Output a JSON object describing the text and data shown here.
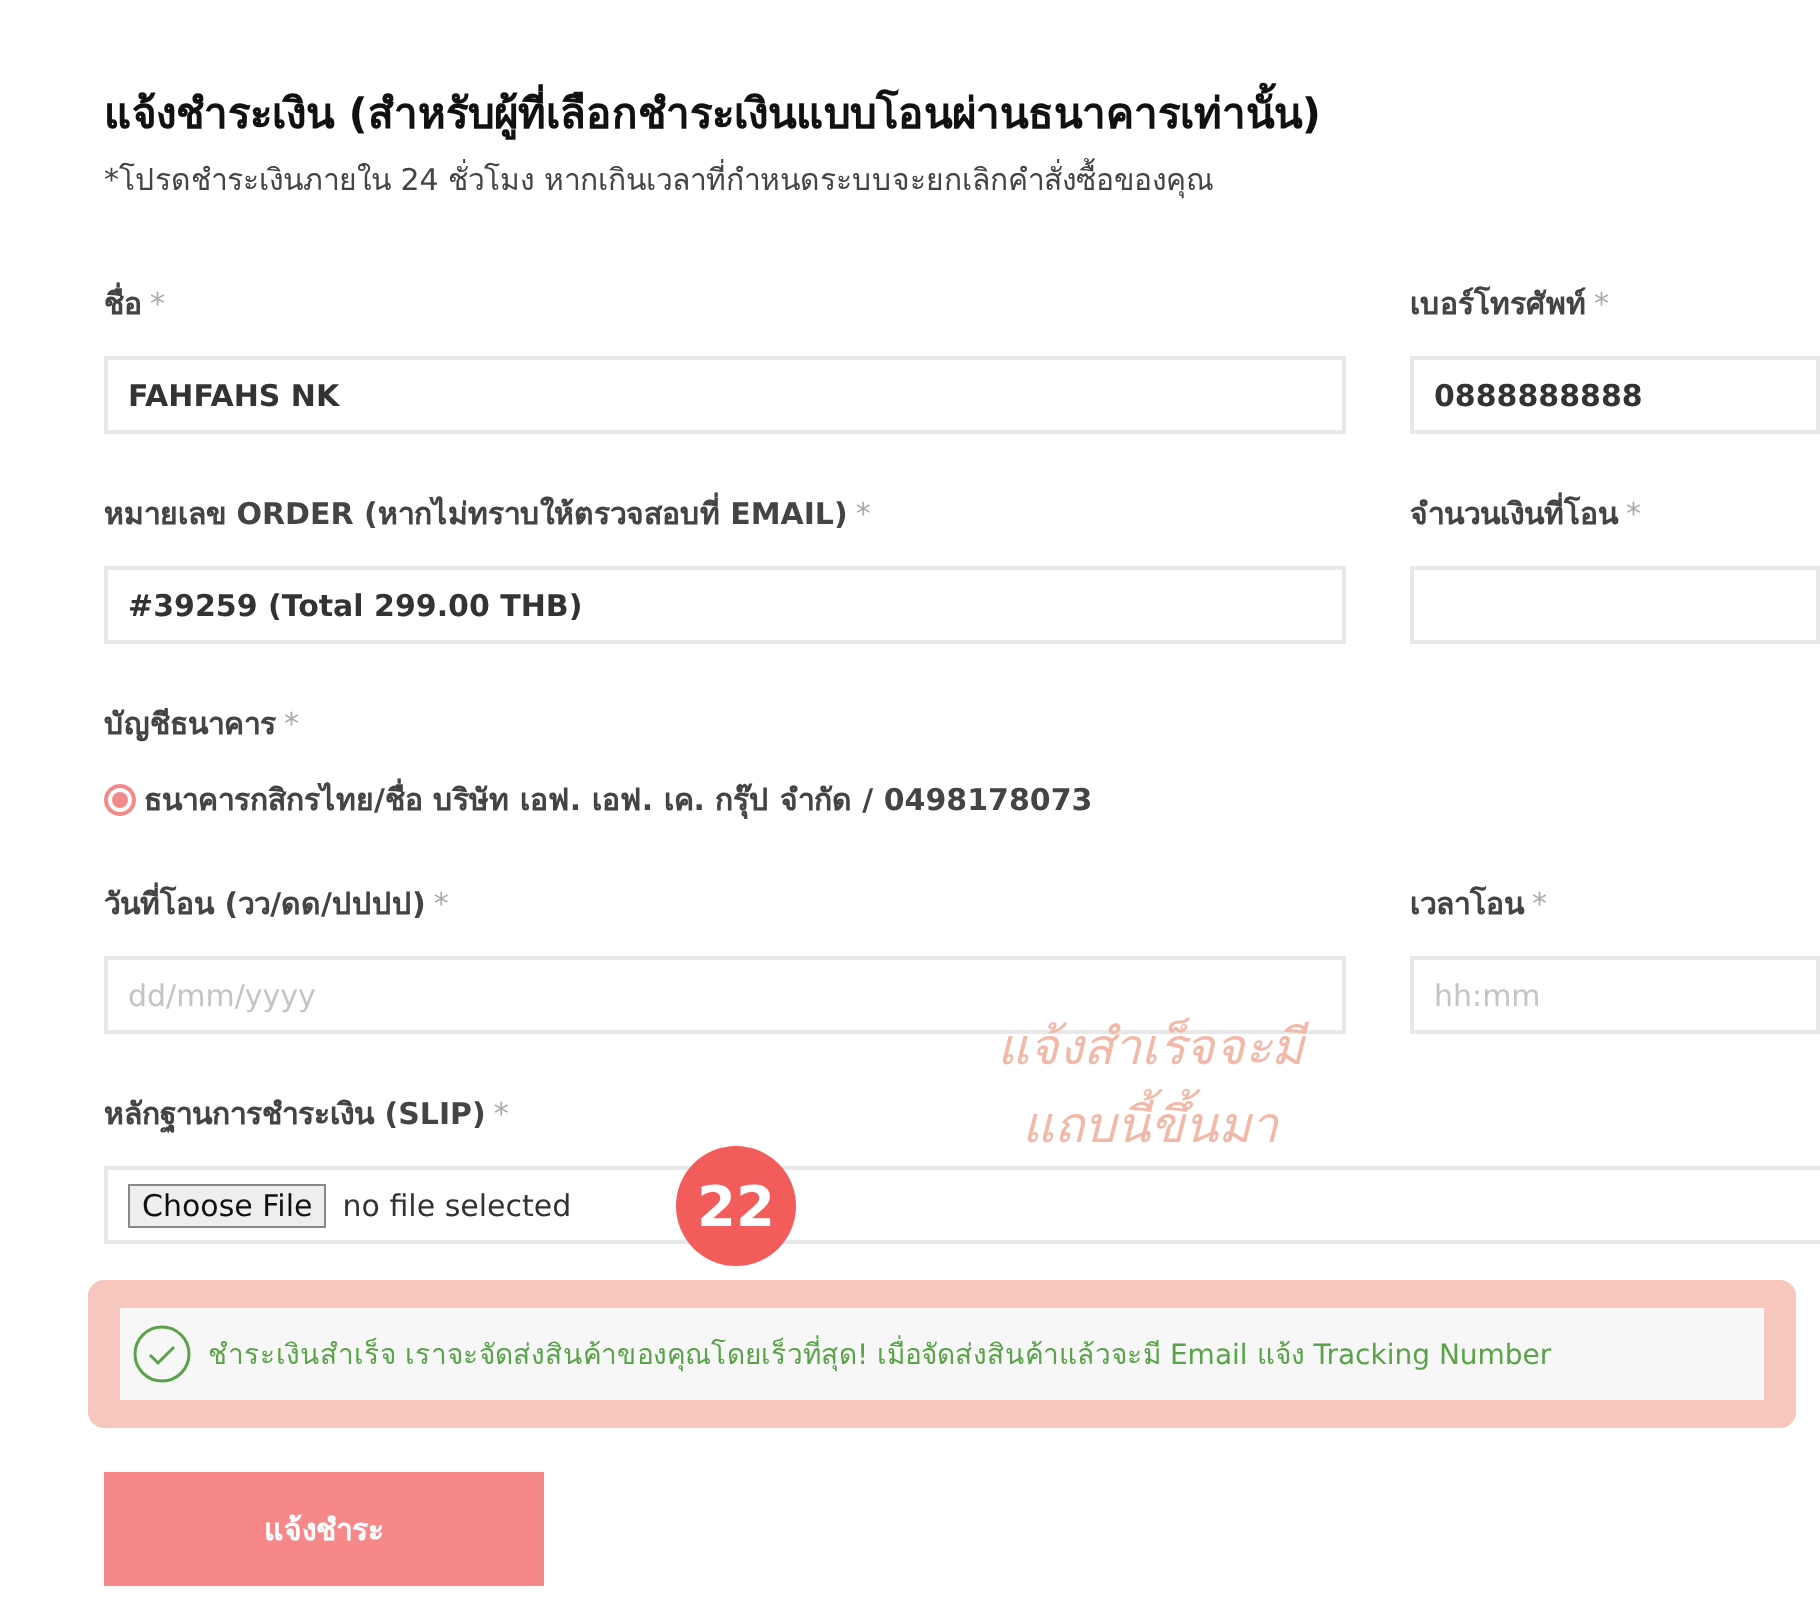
{
  "title": "แจ้งชำระเงิน (สำหรับผู้ที่เลือกชำระเงินแบบโอนผ่านธนาคารเท่านั้น)",
  "note": "*โปรดชำระเงินภายใน 24 ชั่วโมง หากเกินเวลาที่กำหนดระบบจะยกเลิกคำสั่งซื้อของคุณ",
  "rows": [
    {
      "fields": [
        {
          "kind": "text",
          "label": "ชื่อ",
          "mark": "*",
          "value": "FAHFAHS NK"
        },
        {
          "kind": "text",
          "label": "เบอร์โทรศัพท์",
          "mark": "*",
          "value": "0888888888"
        }
      ]
    },
    {
      "fields": [
        {
          "kind": "text",
          "label": "หมายเลข ORDER (หากไม่ทราบให้ตรวจสอบที่ EMAIL)",
          "mark": "*",
          "value": "#39259 (Total 299.00 THB)"
        },
        {
          "kind": "text",
          "label": "จำนวนเงินที่โอน",
          "mark": "*"
        }
      ]
    },
    {
      "fields": [
        {
          "kind": "radio",
          "label": "บัญชีธนาคาร",
          "mark": "*",
          "options": [
            {
              "label": "ธนาคารกสิกรไทย/ชื่อ บริษัท เอฟ. เอฟ. เค. กรุ๊ป จำกัด / 0498178073",
              "selected": true
            }
          ]
        }
      ]
    },
    {
      "fields": [
        {
          "kind": "text",
          "label": "วันที่โอน (วว/ดด/ปปปป)",
          "mark": "*",
          "placeholder": "dd/mm/yyyy"
        },
        {
          "kind": "text",
          "label": "เวลาโอน",
          "mark": "*",
          "placeholder": "hh:mm"
        }
      ]
    },
    {
      "fields": [
        {
          "kind": "file",
          "label": "หลักฐานการชำระเงิน (SLIP)",
          "mark": "*",
          "button": "Choose File",
          "status": "no file selected"
        }
      ]
    }
  ],
  "success": "ชำระเงินสำเร็จ เราจะจัดส่งสินค้าของคุณโดยเร็วที่สุด! เมื่อจัดส่งสินค้าแล้วจะมี Email แจ้ง Tracking Number",
  "submit": "แจ้งชำระ",
  "annotation": {
    "lines": [
      "แจ้งสำเร็จจะมี",
      "แถบนี้ขึ้นมา"
    ],
    "badge": "22"
  }
}
